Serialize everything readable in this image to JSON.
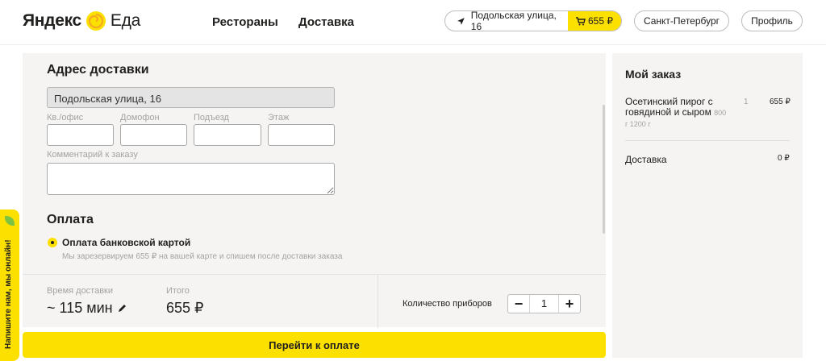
{
  "header": {
    "logo_yandex": "Яндекс",
    "logo_eda": "Еда",
    "nav": [
      "Рестораны",
      "Доставка"
    ],
    "address": "Подольская улица, 16",
    "cart_total": "655 ₽",
    "city": "Санкт-Петербург",
    "profile": "Профиль"
  },
  "delivery": {
    "title": "Адрес доставки",
    "address_value": "Подольская улица, 16",
    "fields": {
      "apartment": "Кв./офис",
      "intercom": "Домофон",
      "entrance": "Подъезд",
      "floor": "Этаж"
    },
    "comment_label": "Комментарий к заказу"
  },
  "payment": {
    "title": "Оплата",
    "option": "Оплата банковской картой",
    "note": "Мы зарезервируем 655 ₽ на вашей карте и спишем после доставки заказа"
  },
  "summary": {
    "time_label": "Время доставки",
    "time_value": "~ 115 мин",
    "total_label": "Итого",
    "total_value": "655 ₽",
    "cutlery_label": "Количество приборов",
    "cutlery_qty": "1",
    "minus": "−",
    "plus": "+"
  },
  "pay_button": "Перейти к оплате",
  "order": {
    "title": "Мой заказ",
    "items": [
      {
        "name": "Осетинский пирог с говядиной и сыром",
        "weight": "800 г 1200 г",
        "qty": "1",
        "price": "655 ₽"
      }
    ],
    "delivery_label": "Доставка",
    "delivery_price": "0 ₽"
  },
  "chat_tab": "Напишите нам, мы онлайн!",
  "colors": {
    "accent": "#fce000",
    "panel": "#f5f4f2"
  }
}
